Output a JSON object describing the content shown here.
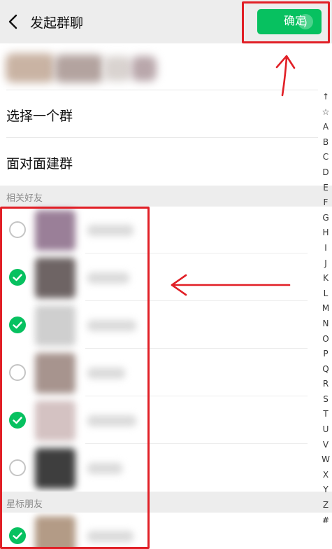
{
  "header": {
    "title": "发起群聊",
    "confirm_label": "确定",
    "confirm_count": ")"
  },
  "menu": {
    "select_group": "选择一个群",
    "face_to_face": "面对面建群"
  },
  "sections": {
    "related_friends": "相关好友",
    "starred_friends": "星标朋友"
  },
  "contacts": [
    {
      "checked": false,
      "avatar_color": "#9a7f98"
    },
    {
      "checked": true,
      "avatar_color": "#6e6464"
    },
    {
      "checked": true,
      "avatar_color": "#cfcfcf"
    },
    {
      "checked": false,
      "avatar_color": "#a7948e"
    },
    {
      "checked": true,
      "avatar_color": "#d4c2c2"
    },
    {
      "checked": false,
      "avatar_color": "#3e3e3e"
    },
    {
      "checked": true,
      "avatar_color": "#b39b86"
    }
  ],
  "index_letters": [
    "↑",
    "☆",
    "A",
    "B",
    "C",
    "D",
    "E",
    "F",
    "G",
    "H",
    "I",
    "J",
    "K",
    "L",
    "M",
    "N",
    "O",
    "P",
    "Q",
    "R",
    "S",
    "T",
    "U",
    "V",
    "W",
    "X",
    "Y",
    "Z",
    "#"
  ],
  "colors": {
    "accent": "#07c160",
    "annotation": "#e11f26",
    "header_bg": "#ededed"
  }
}
